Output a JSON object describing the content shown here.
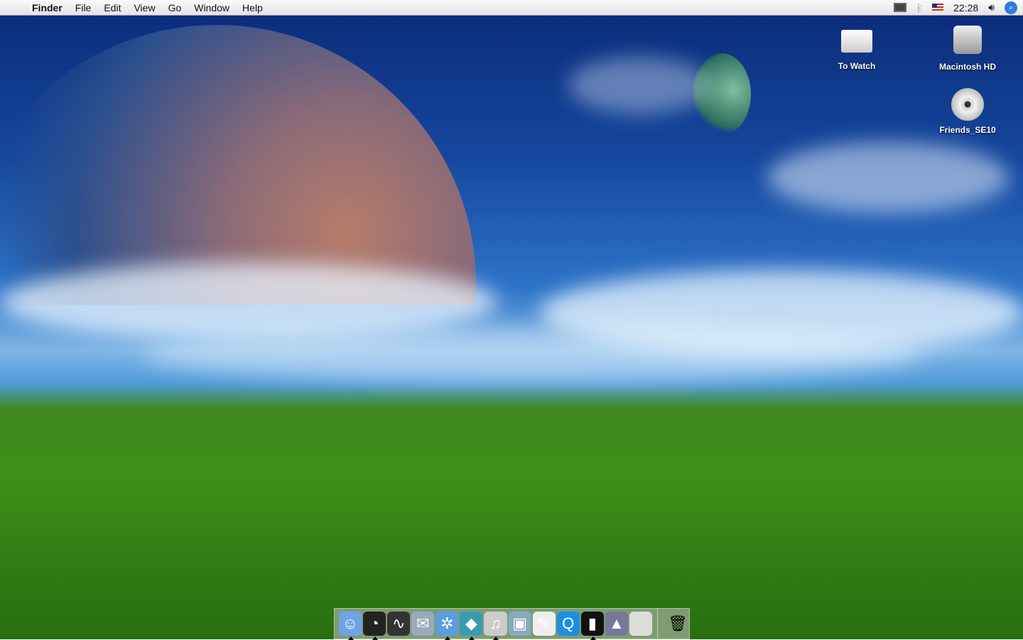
{
  "menubar": {
    "apple": "",
    "app": "Finder",
    "items": [
      "File",
      "Edit",
      "View",
      "Go",
      "Window",
      "Help"
    ],
    "clock": "22:28"
  },
  "status_icons": [
    "display-icon",
    "bluetooth-icon",
    "us-flag-input-icon",
    "volume-icon",
    "spotlight-icon"
  ],
  "desktop_icons": [
    {
      "label": "To Watch",
      "icon": "folder-icon"
    },
    {
      "label": "Macintosh HD",
      "icon": "hard-drive-icon"
    },
    {
      "label": "Friends_SE10",
      "icon": "dvd-icon"
    }
  ],
  "dock": [
    {
      "name": "finder",
      "glyph": "☺",
      "bg": "#6fa3e6",
      "running": true
    },
    {
      "name": "dashboard",
      "glyph": "◔",
      "bg": "#222",
      "running": true
    },
    {
      "name": "activity-monitor",
      "glyph": "∿",
      "bg": "#333",
      "running": false
    },
    {
      "name": "mail",
      "glyph": "✉",
      "bg": "#9ab",
      "running": false
    },
    {
      "name": "safari",
      "glyph": "✲",
      "bg": "#5a9de0",
      "running": true
    },
    {
      "name": "adium",
      "glyph": "◆",
      "bg": "#3a9ab0",
      "running": true
    },
    {
      "name": "itunes",
      "glyph": "♫",
      "bg": "#ccc",
      "running": true
    },
    {
      "name": "iphoto",
      "glyph": "▣",
      "bg": "#8ab",
      "running": false
    },
    {
      "name": "textedit",
      "glyph": "✎",
      "bg": "#eee",
      "running": false
    },
    {
      "name": "quicktime",
      "glyph": "Q",
      "bg": "#1c8fe0",
      "running": false
    },
    {
      "name": "ipod",
      "glyph": "▮",
      "bg": "#111",
      "running": true
    },
    {
      "name": "vlc-window",
      "glyph": "▲",
      "bg": "#779",
      "running": false
    },
    {
      "name": "system-preferences",
      "glyph": "",
      "bg": "#ddd",
      "running": false
    }
  ],
  "trash": {
    "glyph": "🗑"
  }
}
